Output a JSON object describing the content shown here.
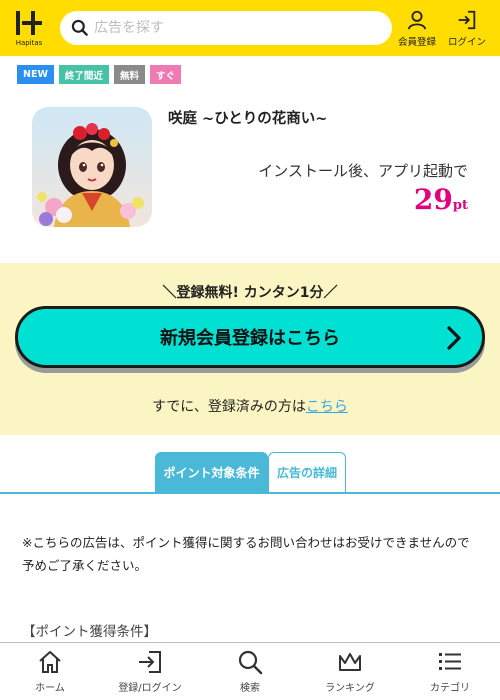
{
  "header": {
    "logo_text": "Hapitas",
    "search_placeholder": "広告を探す",
    "register_label": "会員登録",
    "login_label": "ログイン"
  },
  "tags": [
    "NEW",
    "終了間近",
    "無料",
    "すぐ"
  ],
  "app": {
    "title": "咲庭 ~ひとりの花商い~",
    "condition": "インストール後、アプリ起動で",
    "points": "29",
    "points_unit": "pt"
  },
  "registration": {
    "banner": "＼登録無料! カンタン1分／",
    "button_label": "新規会員登録はこちら",
    "already_text": "すでに、登録済みの方は",
    "login_link": "こちら"
  },
  "tabs": [
    {
      "label": "ポイント対象条件",
      "active": true
    },
    {
      "label": "広告の詳細",
      "active": false
    }
  ],
  "notice": "※こちらの広告は、ポイント獲得に関するお問い合わせはお受けできませんので予めご了承ください。",
  "conditions_heading": "【ポイント獲得条件】",
  "bottom_nav": [
    {
      "label": "ホーム",
      "icon": "home-icon"
    },
    {
      "label": "登録/ログイン",
      "icon": "login-icon"
    },
    {
      "label": "検索",
      "icon": "search-icon"
    },
    {
      "label": "ランキング",
      "icon": "crown-icon"
    },
    {
      "label": "カテゴリ",
      "icon": "list-icon"
    }
  ],
  "colors": {
    "header_bg": "#ffdd00",
    "register_btn": "#00e1d3",
    "points": "#e3007f",
    "tab_active": "#4ab9d8",
    "reg_bg": "#fbf5c3"
  }
}
